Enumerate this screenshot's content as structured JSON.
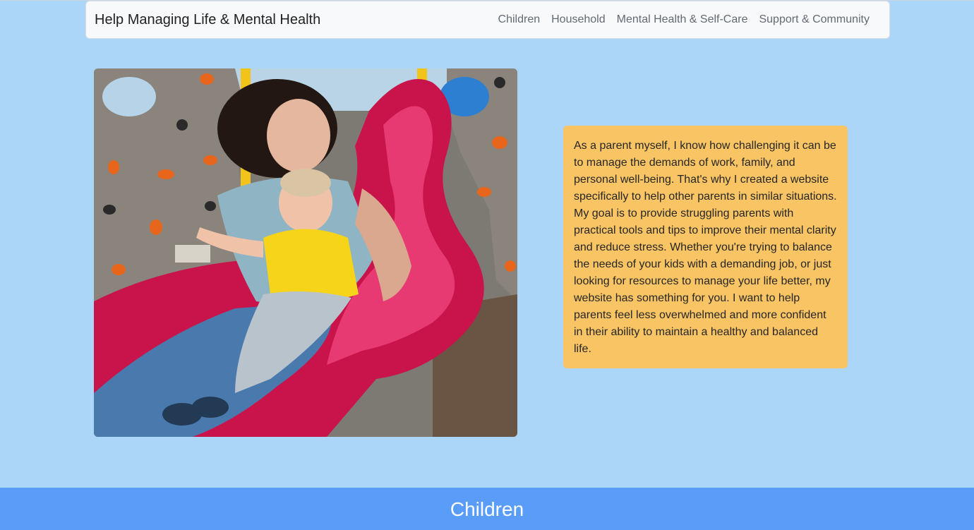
{
  "navbar": {
    "brand": "Help Managing Life & Mental Health",
    "links": [
      {
        "label": "Children"
      },
      {
        "label": "Household"
      },
      {
        "label": "Mental Health & Self-Care"
      },
      {
        "label": "Support & Community"
      }
    ]
  },
  "hero": {
    "image_icon": "parent-child-slide-photo",
    "intro_text": "As a parent myself, I know how challenging it can be to manage the demands of work, family, and personal well-being. That's why I created a website specifically to help other parents in similar situations. My goal is to provide struggling parents with practical tools and tips to improve their mental clarity and reduce stress. Whether you're trying to balance the needs of your kids with a demanding job, or just looking for resources to manage your life better, my website has something for you. I want to help parents feel less overwhelmed and more confident in their ability to maintain a healthy and balanced life."
  },
  "section": {
    "title": "Children"
  },
  "colors": {
    "page_background": "#abd6f8",
    "intro_box": "#f9c463",
    "section_band": "#5a9df8"
  }
}
